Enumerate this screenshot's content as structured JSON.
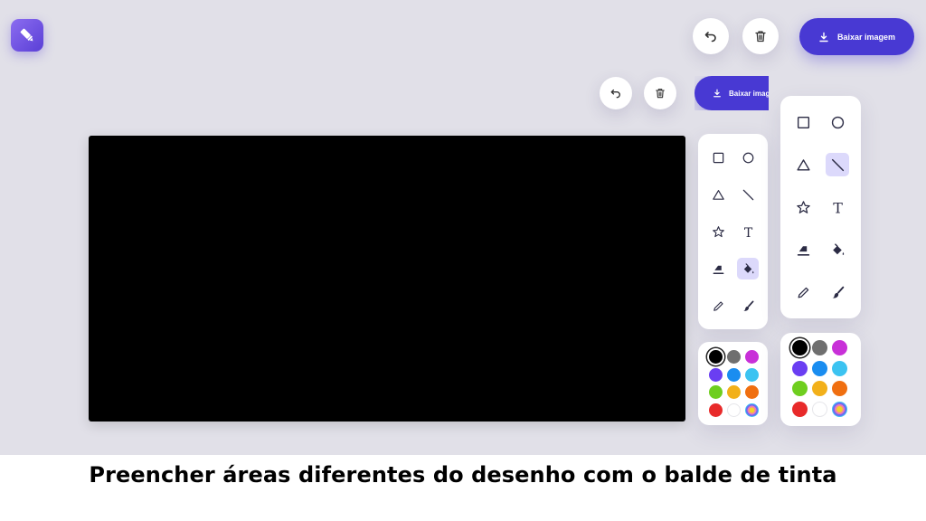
{
  "app": {
    "logo_icon": "brush-pen-icon"
  },
  "toolbar": {
    "undo_icon": "undo-icon",
    "delete_icon": "trash-icon",
    "download_icon": "download-icon",
    "download_label": "Baixar imagem"
  },
  "toolbar_inset": {
    "download_label": "Baixar image"
  },
  "tools": [
    {
      "name": "square",
      "icon": "square-icon"
    },
    {
      "name": "circle",
      "icon": "circle-icon"
    },
    {
      "name": "triangle",
      "icon": "triangle-icon"
    },
    {
      "name": "line",
      "icon": "line-icon"
    },
    {
      "name": "star",
      "icon": "star-icon"
    },
    {
      "name": "text",
      "icon": "text-icon",
      "glyph": "T"
    },
    {
      "name": "eraser",
      "icon": "eraser-icon"
    },
    {
      "name": "fill",
      "icon": "paint-bucket-icon"
    },
    {
      "name": "pencil",
      "icon": "pencil-icon"
    },
    {
      "name": "brush",
      "icon": "brush-icon"
    }
  ],
  "active_tool_left_panel": "fill",
  "active_tool_right_panel": "line",
  "colors": [
    "#000000",
    "#6f6f6f",
    "#c830d8",
    "#6a3ef2",
    "#1a8df0",
    "#3cc3f1",
    "#6fce1f",
    "#f2b01a",
    "#f06f10",
    "#e82a2a",
    "#ffffff",
    "rainbow"
  ],
  "selected_color": "#000000",
  "caption": "Preencher áreas diferentes do desenho com o balde de tinta"
}
